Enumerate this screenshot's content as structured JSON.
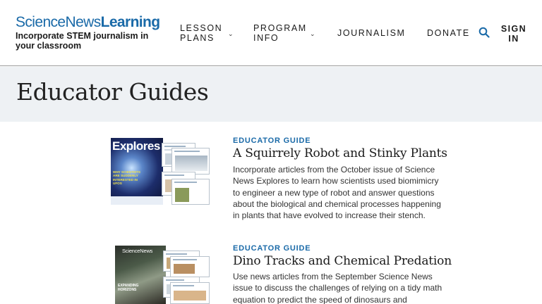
{
  "brand": {
    "name_part1": "ScienceNews",
    "name_part2": "Learning",
    "tagline": "Incorporate STEM journalism in your classroom",
    "accent_color": "#1a6aa8"
  },
  "nav": {
    "lesson_plans": "LESSON PLANS",
    "program_info": "PROGRAM INFO",
    "journalism": "JOURNALISM",
    "donate": "DONATE",
    "sign_in": "SIGN IN",
    "search_icon": "search-icon",
    "chevron_icon": "chevron-down-icon"
  },
  "page": {
    "title": "Educator Guides"
  },
  "guides": [
    {
      "kicker": "EDUCATOR GUIDE",
      "title": "A Squirrely Robot and Stinky Plants",
      "description": "Incorporate articles from the October issue of Science News Explores to learn how scientists used biomimicry to engineer a new type of robot and answer questions about the biological and chemical processes happening in plants that have evolved to increase their stench.",
      "thumbnail": {
        "cover_title": "Explores",
        "cover_headline": "WHY SCIENTISTS ARE SUDDENLY INTERESTED IN UFOS"
      }
    },
    {
      "kicker": "EDUCATOR GUIDE",
      "title": "Dino Tracks and Chemical Predation",
      "description": "Use news articles from the September Science News issue to discuss the challenges of relying on a tidy math equation to predict the speed of dinosaurs and",
      "thumbnail": {
        "cover_title": "ScienceNews",
        "cover_headline": "EXPANDING HORIZONS"
      }
    }
  ]
}
